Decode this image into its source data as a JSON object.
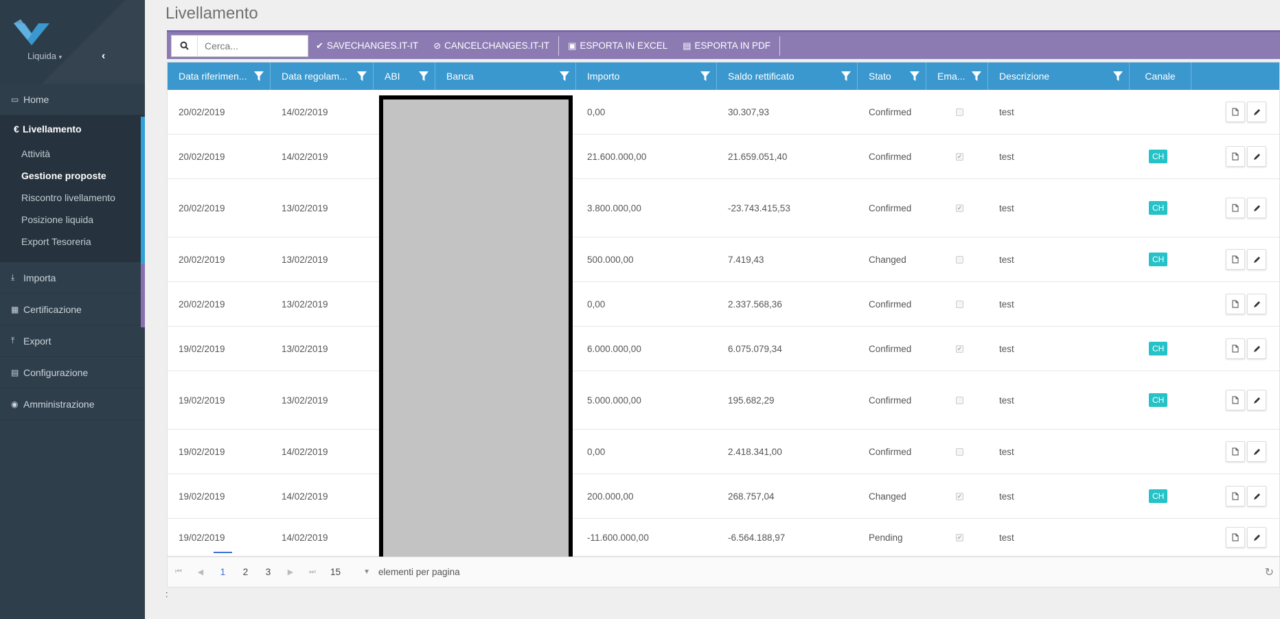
{
  "sidebar": {
    "brand": "Liquida",
    "nav_top": [
      {
        "label": "Home"
      }
    ],
    "active_section": {
      "label": "Livellamento",
      "items": [
        {
          "label": "Attività"
        },
        {
          "label": "Gestione proposte"
        },
        {
          "label": "Riscontro livellamento"
        },
        {
          "label": "Posizione liquida"
        },
        {
          "label": "Export Tesoreria"
        }
      ]
    },
    "nav_bottom": [
      {
        "label": "Importa"
      },
      {
        "label": "Certificazione"
      },
      {
        "label": "Export"
      },
      {
        "label": "Configurazione"
      },
      {
        "label": "Amministrazione"
      }
    ]
  },
  "page": {
    "title": "Livellamento"
  },
  "toolbar": {
    "search_placeholder": "Cerca...",
    "save": "SAVECHANGES.IT-IT",
    "cancel": "CANCELCHANGES.IT-IT",
    "excel": "ESPORTA IN EXCEL",
    "pdf": "ESPORTA IN PDF"
  },
  "table": {
    "columns": [
      "Data riferimen...",
      "Data regolam...",
      "ABI",
      "Banca",
      "Importo",
      "Saldo rettificato",
      "Stato",
      "Ema...",
      "Descrizione",
      "Canale"
    ],
    "rows": [
      {
        "data_rif": "20/02/2019",
        "data_reg": "14/02/2019",
        "importo": "0,00",
        "saldo": "30.307,93",
        "stato": "Confirmed",
        "email": false,
        "descr": "test",
        "canale": ""
      },
      {
        "data_rif": "20/02/2019",
        "data_reg": "14/02/2019",
        "importo": "21.600.000,00",
        "saldo": "21.659.051,40",
        "stato": "Confirmed",
        "email": true,
        "descr": "test",
        "canale": "CH"
      },
      {
        "data_rif": "20/02/2019",
        "data_reg": "13/02/2019",
        "importo": "3.800.000,00",
        "saldo": "-23.743.415,53",
        "stato": "Confirmed",
        "email": true,
        "descr": "test",
        "canale": "CH"
      },
      {
        "data_rif": "20/02/2019",
        "data_reg": "13/02/2019",
        "importo": "500.000,00",
        "saldo": "7.419,43",
        "stato": "Changed",
        "email": false,
        "descr": "test",
        "canale": "CH"
      },
      {
        "data_rif": "20/02/2019",
        "data_reg": "13/02/2019",
        "importo": "0,00",
        "saldo": "2.337.568,36",
        "stato": "Confirmed",
        "email": false,
        "descr": "test",
        "canale": ""
      },
      {
        "data_rif": "19/02/2019",
        "data_reg": "13/02/2019",
        "importo": "6.000.000,00",
        "saldo": "6.075.079,34",
        "stato": "Confirmed",
        "email": true,
        "descr": "test",
        "canale": "CH"
      },
      {
        "data_rif": "19/02/2019",
        "data_reg": "13/02/2019",
        "importo": "5.000.000,00",
        "saldo": "195.682,29",
        "stato": "Confirmed",
        "email": false,
        "descr": "test",
        "canale": "CH"
      },
      {
        "data_rif": "19/02/2019",
        "data_reg": "14/02/2019",
        "importo": "0,00",
        "saldo": "2.418.341,00",
        "stato": "Confirmed",
        "email": false,
        "descr": "test",
        "canale": ""
      },
      {
        "data_rif": "19/02/2019",
        "data_reg": "14/02/2019",
        "importo": "200.000,00",
        "saldo": "268.757,04",
        "stato": "Changed",
        "email": true,
        "descr": "test",
        "canale": "CH"
      },
      {
        "data_rif": "19/02/2019",
        "data_reg": "14/02/2019",
        "importo": "-11.600.000,00",
        "saldo": "-6.564.188,97",
        "stato": "Pending",
        "email": true,
        "descr": "test",
        "canale": ""
      }
    ]
  },
  "pager": {
    "pages": [
      "1",
      "2",
      "3"
    ],
    "current": "1",
    "page_size": "15",
    "per_page_label": "elementi per pagina"
  },
  "footer": {
    "text": ":"
  },
  "colors": {
    "header": "#3a98cf",
    "toolbar": "#8c7bb3",
    "sidebar": "#2f3e4b",
    "badge": "#25c2c7"
  }
}
